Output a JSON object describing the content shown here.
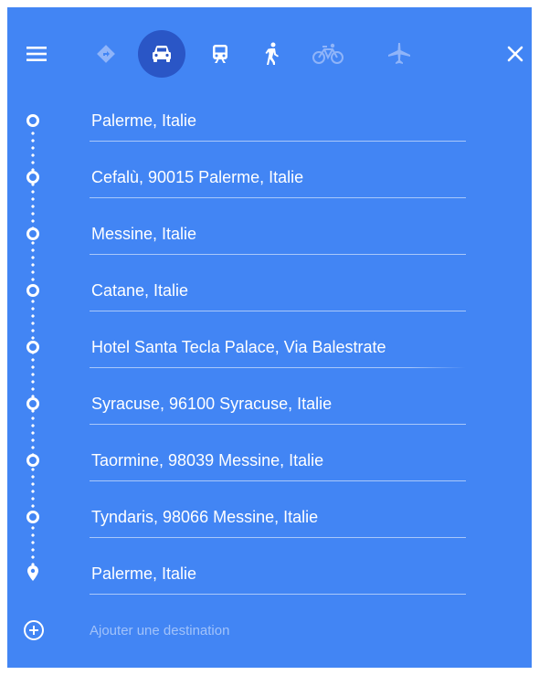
{
  "colors": {
    "panel_bg": "#4285f4",
    "selected_mode_bg": "#2a56c6",
    "text": "#ffffff",
    "disabled_icon": "#8fb4f9",
    "placeholder": "#a0c2fa"
  },
  "toolbar": {
    "menu_icon": "hamburger-menu-icon",
    "modes": [
      {
        "name": "best-route",
        "icon": "diamond-arrow-icon",
        "selected": false
      },
      {
        "name": "driving",
        "icon": "car-icon",
        "selected": true
      },
      {
        "name": "transit",
        "icon": "train-icon",
        "selected": false
      },
      {
        "name": "walking",
        "icon": "walk-icon",
        "selected": false
      },
      {
        "name": "cycling",
        "icon": "bike-icon",
        "selected": false
      },
      {
        "name": "flights",
        "icon": "plane-icon",
        "selected": false
      }
    ],
    "close_icon": "close-icon"
  },
  "stops": [
    {
      "value": "Palerme, Italie"
    },
    {
      "value": "Cefalù, 90015 Palerme, Italie"
    },
    {
      "value": "Messine, Italie"
    },
    {
      "value": "Catane, Italie"
    },
    {
      "value": "Hotel Santa Tecla Palace, Via Balestrate"
    },
    {
      "value": "Syracuse, 96100 Syracuse, Italie"
    },
    {
      "value": "Taormine, 98039 Messine, Italie"
    },
    {
      "value": "Tyndaris, 98066 Messine, Italie"
    },
    {
      "value": "Palerme, Italie"
    }
  ],
  "add_destination": {
    "placeholder": "Ajouter une destination",
    "icon": "add-circle-icon"
  }
}
